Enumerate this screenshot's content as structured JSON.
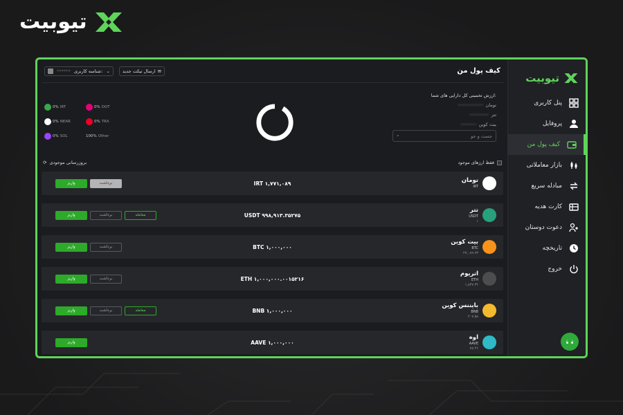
{
  "brand": {
    "name": "تیوبیت",
    "accent": "#5fd45b"
  },
  "header": {
    "page_title": "کیف پول من",
    "user_label": "شناسه کاربری:",
    "user_value": "******",
    "ticket_label": "ارسال تیکت جدید"
  },
  "summary": {
    "estimate_label": "ارزش تخمینی کل دارایی های شما:",
    "lines": [
      {
        "value": "•••••••••••••",
        "unit": "تومان"
      },
      {
        "value": "••••••••••",
        "unit": "تتر"
      },
      {
        "value": "••••••••",
        "unit": "بیت کوین"
      }
    ],
    "search_placeholder": "جست و جو",
    "legend": [
      {
        "pct": "0%",
        "sym": "IRT",
        "color": "#3aa84a",
        "icon": "iran-flag-icon"
      },
      {
        "pct": "0%",
        "sym": "DOT",
        "color": "#e6007a",
        "icon": "polkadot-icon"
      },
      {
        "pct": "0%",
        "sym": "NEAR",
        "color": "#ffffff",
        "icon": "near-icon"
      },
      {
        "pct": "0%",
        "sym": "TRX",
        "color": "#ef0027",
        "icon": "tron-icon"
      },
      {
        "pct": "0%",
        "sym": "SOL",
        "color": "#9945ff",
        "icon": "solana-icon"
      },
      {
        "pct": "100%",
        "sym": "Other",
        "color": "#ffffff",
        "icon": ""
      }
    ]
  },
  "filters": {
    "refresh_label": "بروزرسانی موجودی",
    "only_available_label": "فقط ارزهای موجود"
  },
  "buttons": {
    "deposit": "واریز",
    "withdraw": "برداشت",
    "trade": "معامله"
  },
  "assets": [
    {
      "name": "تومان",
      "sym": "IRT",
      "price": "",
      "balance": "IRT ۱,۷۷۱,۰۸۹",
      "color": "#ffffff",
      "icon": "iran-flag-icon",
      "show_withdraw": true,
      "withdraw_light": true,
      "show_trade": false
    },
    {
      "name": "تتر",
      "sym": "USDT",
      "price": "۱",
      "balance": "USDT ۹۹۸,۹۱۳.۳۵۲۷۵",
      "color": "#26a17b",
      "icon": "tether-icon",
      "show_withdraw": true,
      "withdraw_light": false,
      "show_trade": true
    },
    {
      "name": "بیت کوین",
      "sym": "BTC",
      "price": "۲۷,۰۸۹.۹۳",
      "balance": "BTC ۱,۰۰۰,۰۰۰",
      "color": "#f7931a",
      "icon": "bitcoin-icon",
      "show_withdraw": true,
      "withdraw_light": false,
      "show_trade": false
    },
    {
      "name": "اتریوم",
      "sym": "ETH",
      "price": "۱,۸۳۷.۳۲",
      "balance": "ETH ۱,۰۰۰,۰۰۰.۰۰۱۵۲۱۶",
      "color": "#4d4d4f",
      "icon": "ethereum-icon",
      "show_withdraw": true,
      "withdraw_light": false,
      "show_trade": false
    },
    {
      "name": "بایننس کوین",
      "sym": "BNB",
      "price": "۲۰۷.۵۸",
      "balance": "BNB ۱,۰۰۰,۰۰۰",
      "color": "#f3ba2f",
      "icon": "binance-icon",
      "show_withdraw": true,
      "withdraw_light": false,
      "show_trade": true
    },
    {
      "name": "اوه",
      "sym": "AAVE",
      "price": "۷۷.۴۶",
      "balance": "AAVE ۱,۰۰۰,۰۰۰",
      "color": "#2ebac6",
      "icon": "aave-icon",
      "show_withdraw": false,
      "withdraw_light": false,
      "show_trade": false
    }
  ],
  "sidebar": {
    "items": [
      {
        "label": "پنل کاربری",
        "icon": "dashboard-icon",
        "active": false
      },
      {
        "label": "پروفایل",
        "icon": "user-icon",
        "active": false
      },
      {
        "label": "کیف پول من",
        "icon": "wallet-icon",
        "active": true
      },
      {
        "label": "بازار معاملاتی",
        "icon": "market-icon",
        "active": false
      },
      {
        "label": "مبادله سریع",
        "icon": "exchange-icon",
        "active": false
      },
      {
        "label": "کارت هدیه",
        "icon": "gift-card-icon",
        "active": false
      },
      {
        "label": "دعوت دوستان",
        "icon": "invite-icon",
        "active": false
      },
      {
        "label": "تاریخچه",
        "icon": "history-icon",
        "active": false
      },
      {
        "label": "خروج",
        "icon": "logout-icon",
        "active": false
      }
    ]
  }
}
